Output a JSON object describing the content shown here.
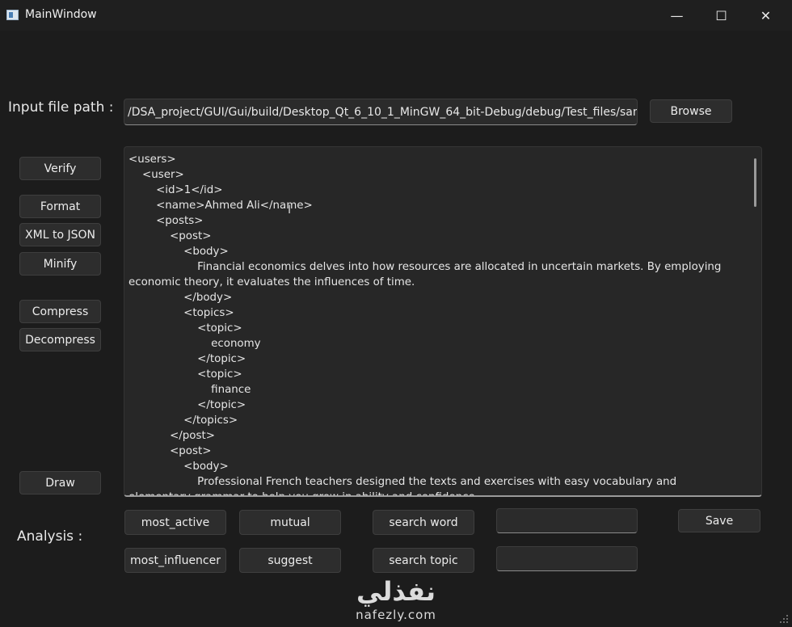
{
  "window": {
    "title": "MainWindow",
    "minimize_glyph": "—",
    "maximize_glyph": "☐",
    "close_glyph": "✕"
  },
  "input_file": {
    "label": "Input file path :",
    "value": "/DSA_project/GUI/Gui/build/Desktop_Qt_6_10_1_MinGW_64_bit-Debug/debug/Test_files/sample.xml",
    "browse_label": "Browse"
  },
  "sidebar": {
    "verify": "Verify",
    "format": "Format",
    "xml_to_json": "XML to JSON",
    "minify": "Minify",
    "compress": "Compress",
    "decompress": "Decompress",
    "draw": "Draw"
  },
  "editor": {
    "lines": [
      "<users>",
      "    <user>",
      "        <id>1</id>",
      "        <name>Ahmed Ali</name>",
      "        <posts>",
      "            <post>",
      "                <body>",
      "                    Financial economics delves into how resources are allocated in uncertain markets. By employing economic theory, it evaluates the influences of time.",
      "                </body>",
      "                <topics>",
      "                    <topic>",
      "                        economy",
      "                    </topic>",
      "                    <topic>",
      "                        finance",
      "                    </topic>",
      "                </topics>",
      "            </post>",
      "            <post>",
      "                <body>",
      "                    Professional French teachers designed the texts and exercises with easy vocabulary and elementary grammar to help you grow in ability and confidence."
    ]
  },
  "analysis": {
    "label": "Analysis :",
    "most_active": "most_active",
    "mutual": "mutual",
    "search_word": "search word",
    "most_influencer": "most_influencer",
    "suggest": "suggest",
    "search_topic": "search topic",
    "search_word_value": "",
    "search_topic_value": "",
    "save": "Save"
  },
  "watermark": {
    "arabic": "نفذلي",
    "latin": "nafezly.com"
  }
}
